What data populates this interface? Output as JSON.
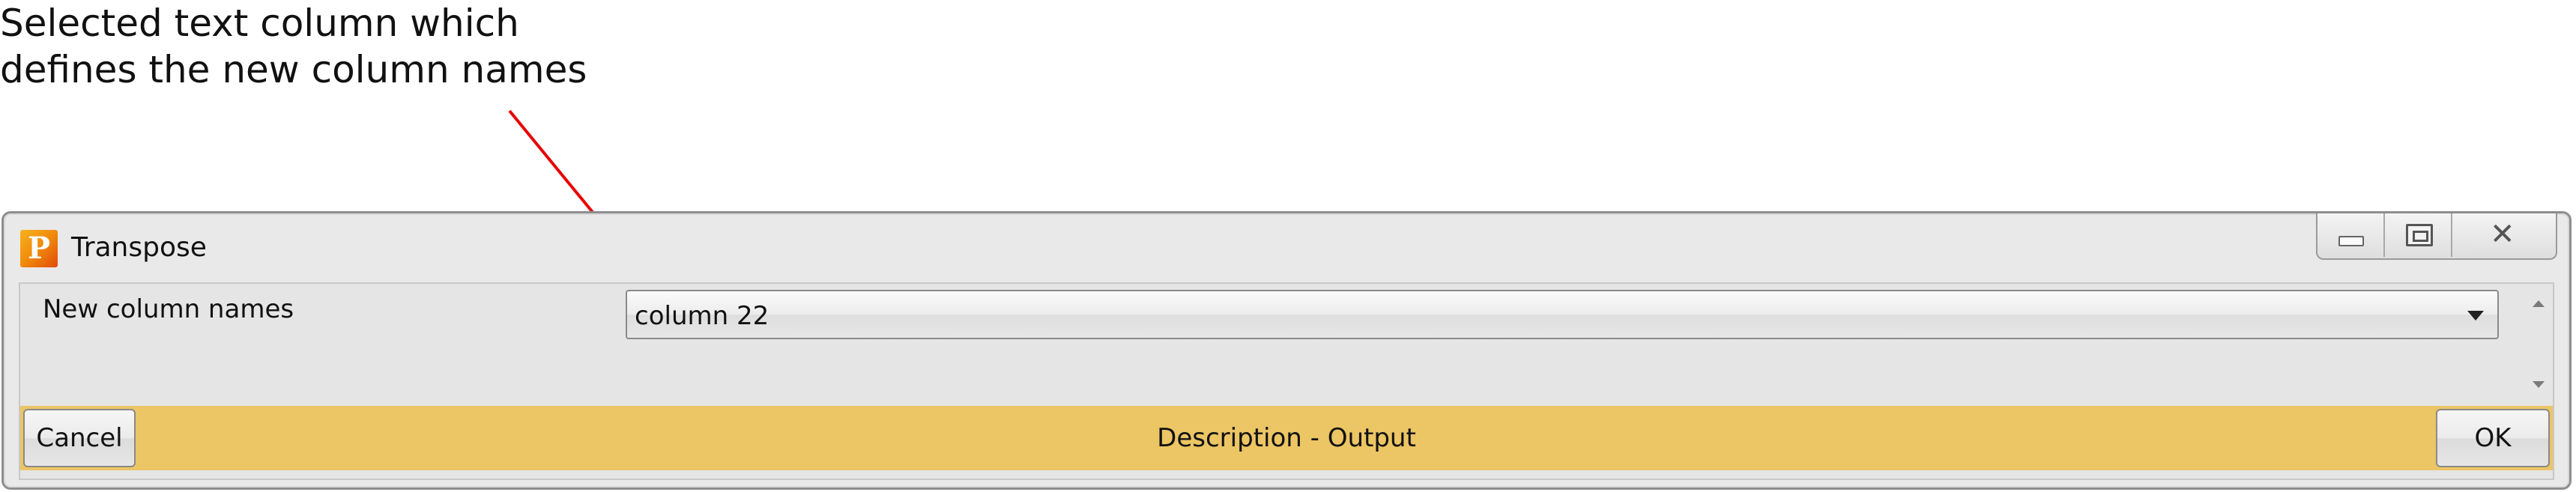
{
  "annotation": {
    "line1": "Selected text column which",
    "line2": "defines the new column names",
    "arrow_color": "#e60000"
  },
  "window": {
    "title": "Transpose",
    "app_icon": "P"
  },
  "parameters": {
    "new_column_names": {
      "label": "New column names",
      "value": "column 22"
    }
  },
  "bottom_bar": {
    "cancel_label": "Cancel",
    "center_text": "Description - Output",
    "ok_label": "OK",
    "background_color": "#ecc564"
  }
}
